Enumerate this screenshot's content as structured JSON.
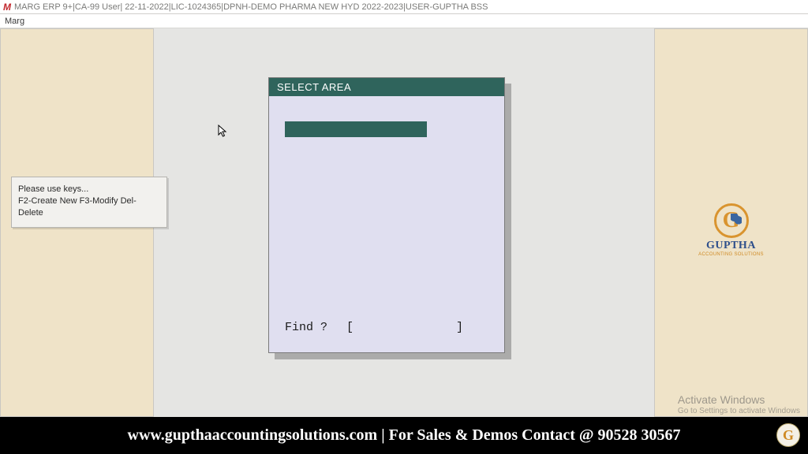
{
  "titlebar": {
    "text": "MARG ERP 9+|CA-99 User| 22-11-2022|LIC-1024365|DPNH-DEMO PHARMA NEW HYD 2022-2023|USER-GUPTHA BSS"
  },
  "menubar": {
    "item": "Marg"
  },
  "hint": {
    "line1": "Please use keys...",
    "line2": "F2-Create New  F3-Modify  Del-Delete"
  },
  "dialog": {
    "title": "SELECT AREA",
    "find_label": "Find ?",
    "bracket_open": "[",
    "bracket_close": "]",
    "find_value": ""
  },
  "brand": {
    "letter": "G",
    "name": "GUPTHA",
    "sub": "ACCOUNTING SOLUTIONS"
  },
  "watermark": {
    "title": "Activate Windows",
    "sub": "Go to Settings to activate Windows"
  },
  "footer": {
    "text": "www.gupthaaccountingsolutions.com | For Sales & Demos Contact @ 90528 30567",
    "coin": "G"
  }
}
